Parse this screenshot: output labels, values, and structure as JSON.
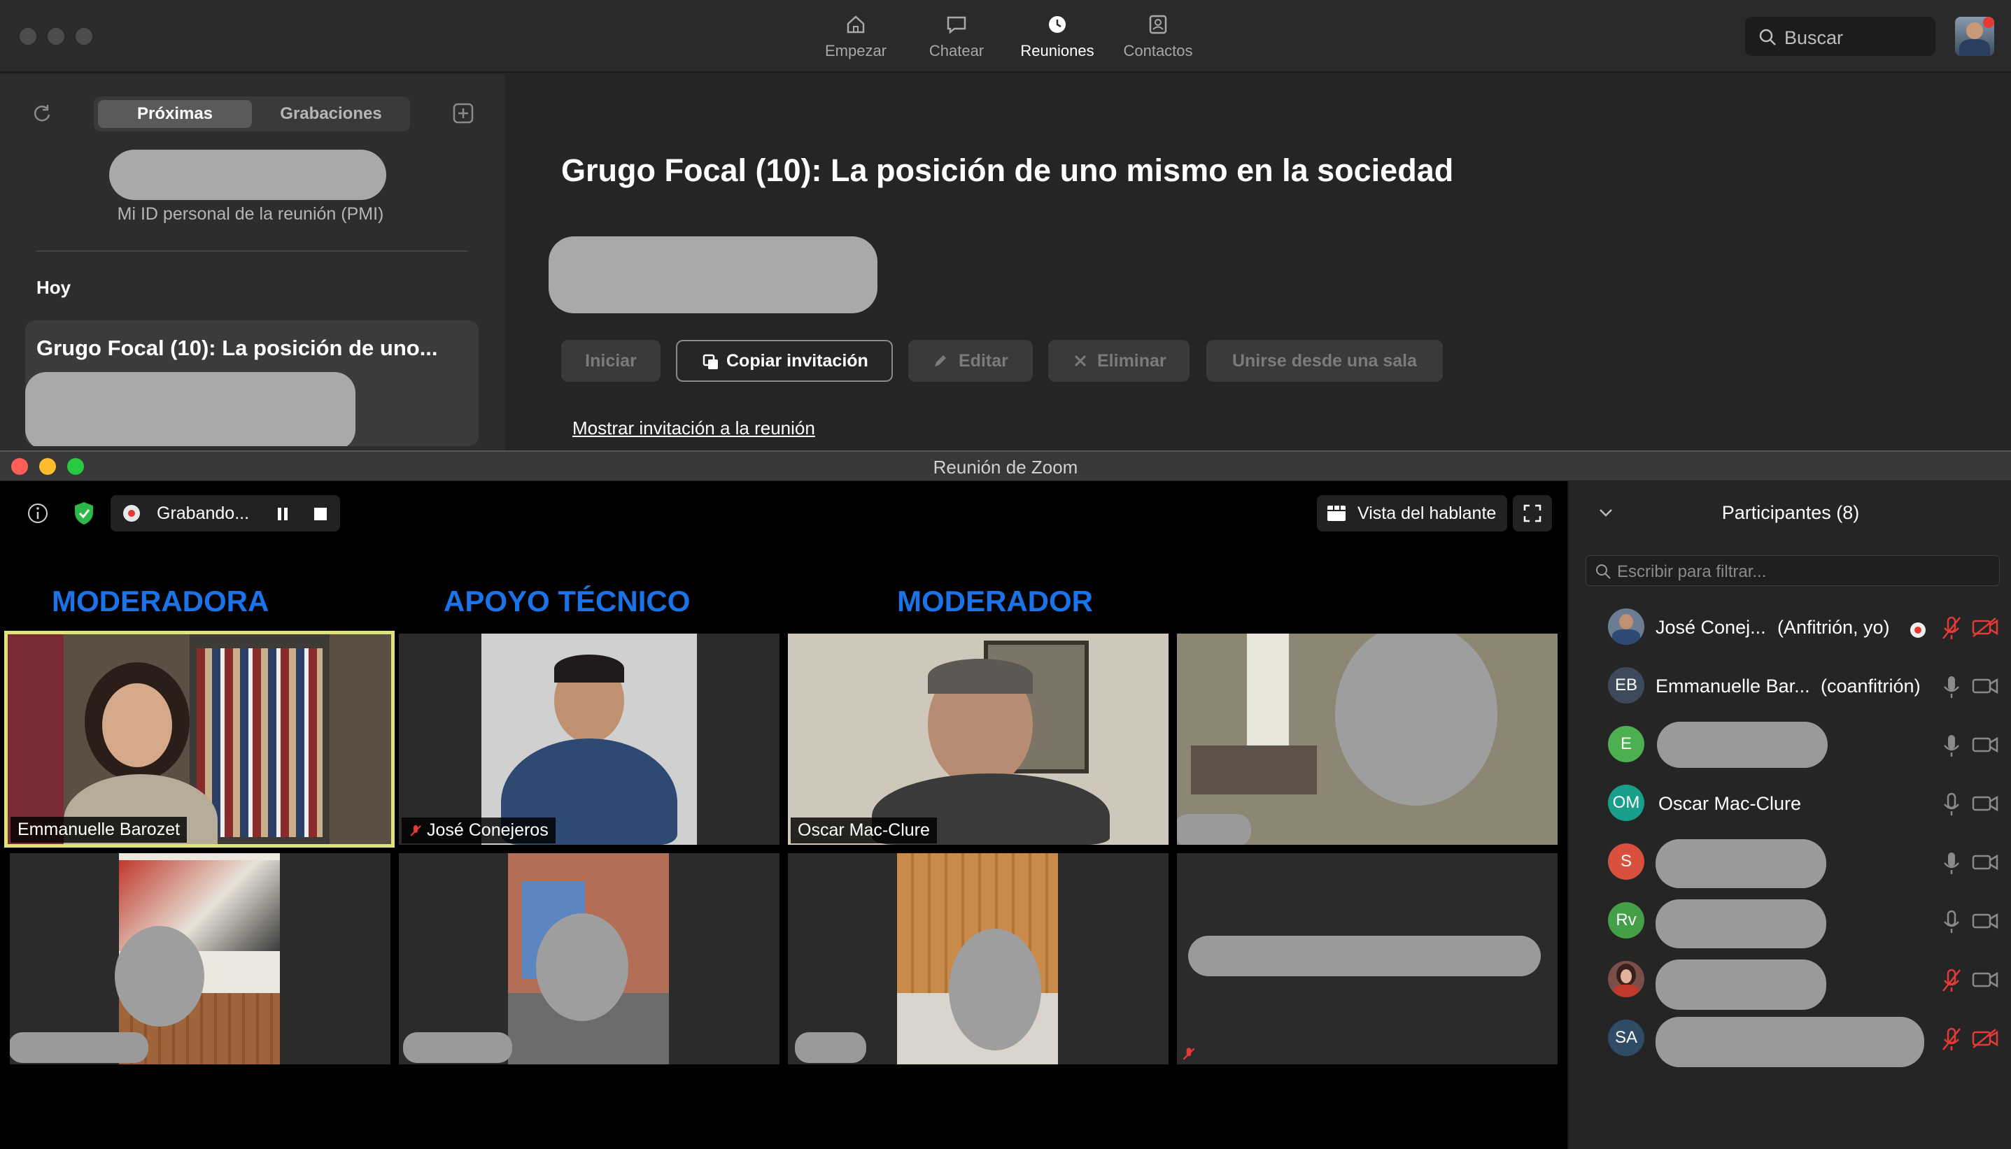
{
  "topnav": {
    "tabs": [
      {
        "label": "Empezar",
        "icon": "home-icon"
      },
      {
        "label": "Chatear",
        "icon": "chat-icon"
      },
      {
        "label": "Reuniones",
        "icon": "clock-icon"
      },
      {
        "label": "Contactos",
        "icon": "contacts-icon"
      }
    ],
    "active_tab": "Reuniones",
    "search_placeholder": "Buscar"
  },
  "sidebar": {
    "segments": [
      "Próximas",
      "Grabaciones"
    ],
    "pmi_label": "Mi ID personal de la reunión (PMI)",
    "section_today": "Hoy",
    "meeting_card_title": "Grugo Focal (10): La posición de uno..."
  },
  "content": {
    "meeting_title": "Grugo Focal (10): La posición de uno mismo en la sociedad",
    "buttons": {
      "start": "Iniciar",
      "copy": "Copiar invitación",
      "edit": "Editar",
      "delete": "Eliminar",
      "join_room": "Unirse desde una sala"
    },
    "show_invitation": "Mostrar invitación a la reunión"
  },
  "meeting": {
    "window_title": "Reunión de Zoom",
    "recording_label": "Grabando...",
    "view_label": "Vista del hablante",
    "roles": [
      "MODERADORA",
      "APOYO TÉCNICO",
      "MODERADOR"
    ],
    "tiles": [
      {
        "name": "Emmanuelle Barozet"
      },
      {
        "name": "José Conejeros"
      },
      {
        "name": "Oscar Mac-Clure"
      }
    ]
  },
  "participants": {
    "header": "Participantes (8)",
    "filter_placeholder": "Escribir para filtrar...",
    "list": [
      {
        "initials": "",
        "name": "José Conej...",
        "role": "(Anfitrión, yo)",
        "color": "#6b7c93"
      },
      {
        "initials": "EB",
        "name": "Emmanuelle Bar...",
        "role": "(coanfitrión)",
        "color": "#3c4a5c"
      },
      {
        "initials": "E",
        "name": "",
        "role": "",
        "color": "#4caf50"
      },
      {
        "initials": "OM",
        "name": "Oscar Mac-Clure",
        "role": "",
        "color": "#1a9e8c"
      },
      {
        "initials": "S",
        "name": "",
        "role": "",
        "color": "#d9503f"
      },
      {
        "initials": "Rv",
        "name": "",
        "role": "",
        "color": "#43a047"
      },
      {
        "initials": "",
        "name": "",
        "role": "",
        "color": "#7a4f4a"
      },
      {
        "initials": "SA",
        "name": "",
        "role": "",
        "color": "#2f4b66"
      }
    ]
  },
  "colors": {
    "accent_blue": "#1a73e8",
    "active_speaker_border": "#dfe37a",
    "mute_red": "#e53935"
  }
}
